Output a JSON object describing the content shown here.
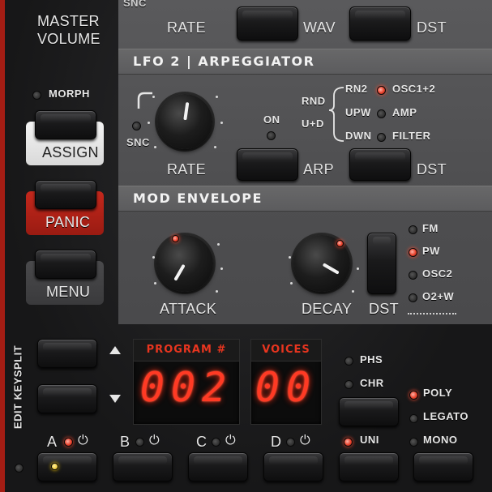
{
  "left": {
    "master_volume": [
      "MASTER",
      "VOLUME"
    ],
    "morph": "MORPH",
    "assign": "ASSIGN",
    "panic": "PANIC",
    "menu": "MENU",
    "edit_keysplit": "EDIT KEYSPLIT"
  },
  "top_row": {
    "snc": "SNC",
    "rate": "RATE",
    "wav": "WAV",
    "dst": "DST"
  },
  "lfo2": {
    "title": "LFO 2 | ARPEGGIATOR",
    "snc": "SNC",
    "rate": "RATE",
    "on": "ON",
    "arp": "ARP",
    "modes": [
      "RND",
      "U+D"
    ],
    "directions": [
      "RN2",
      "UPW",
      "DWN"
    ],
    "destinations": [
      "OSC1+2",
      "AMP",
      "FILTER"
    ],
    "dst": "DST"
  },
  "mod_env": {
    "title": "MOD ENVELOPE",
    "attack": "ATTACK",
    "decay": "DECAY",
    "dst": "DST",
    "destinations": [
      "FM",
      "PW",
      "OSC2",
      "O2+W"
    ]
  },
  "displays": {
    "program_label": "PROGRAM #",
    "program_value": "002",
    "voices_label": "VOICES",
    "voices_value": "00"
  },
  "voice_mode": {
    "phs": "PHS",
    "chr": "CHR",
    "poly": "POLY",
    "legato": "LEGATO",
    "uni": "UNI",
    "mono": "MONO"
  },
  "slots": {
    "a": "A",
    "b": "B",
    "c": "C",
    "d": "D",
    "power_glyph": "⏻"
  },
  "colors": {
    "accent_red": "#c4281c",
    "led_red": "#e8402a",
    "display_red": "#ff3a24"
  }
}
